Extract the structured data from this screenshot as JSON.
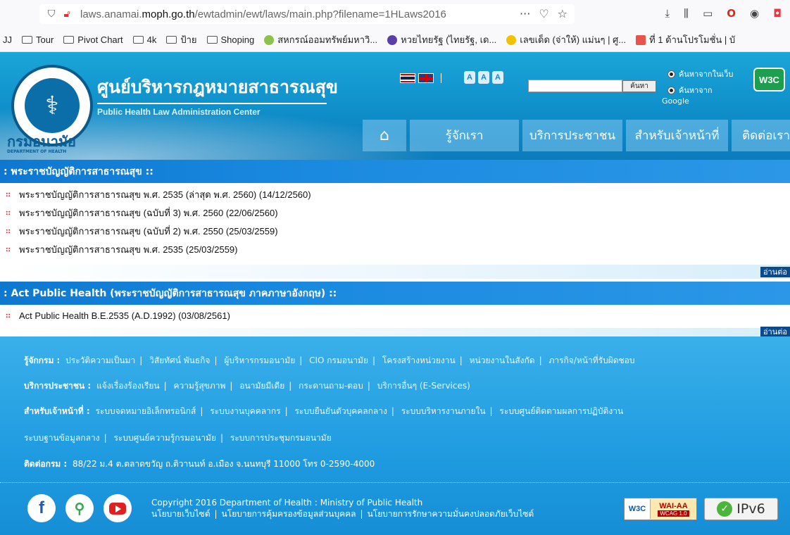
{
  "browser": {
    "url_prefix": "laws.anamai.",
    "url_domain": "moph.go.th",
    "url_path": "/ewtadmin/ewt/laws/main.php?filename=1HLaws2016",
    "bookmarks": [
      {
        "label": "Tour",
        "icon": "folder-icon"
      },
      {
        "label": "Pivot Chart",
        "icon": "folder-icon"
      },
      {
        "label": "4k",
        "icon": "folder-icon"
      },
      {
        "label": "ป้าย",
        "icon": "folder-icon"
      },
      {
        "label": "Shoping",
        "icon": "folder-icon"
      },
      {
        "label": "สหกรณ์ออมทรัพย์มหาวิ...",
        "icon": "coop-icon",
        "color": "#8bc34a"
      },
      {
        "label": "หวยไทยรัฐ (ไทยรัฐ, เด...",
        "icon": "thairath-icon",
        "color": "#5b3fa8"
      },
      {
        "label": "เลขเด็ด (จ่าให้) แม่นๆ | ศู...",
        "icon": "lottery-icon",
        "color": "#f2c200"
      },
      {
        "label": "ที่ 1 ด้านโปรโมชั่น | บั",
        "icon": "promo-icon",
        "color": "#e8534a"
      }
    ]
  },
  "header": {
    "title_th": "ศูนย์บริหารกฎหมายสาธารณสุข",
    "title_en": "Public Health Law Administration Center",
    "dept_th": "กรมอนามัย",
    "dept_en": "DEPARTMENT OF HEALTH",
    "fontsize_labels": [
      "A",
      "A",
      "A"
    ],
    "search_button": "ค้นหา",
    "search_option_site": "ค้นหาจากในเว็บ",
    "search_option_google_1": "ค้นหาจาก",
    "search_option_google_2": "Google",
    "w3c": "W3C",
    "nav": [
      "รู้จักเรา",
      "บริการประชาชน",
      "สำหรับเจ้าหน้าที่",
      "ติดต่อเรา"
    ]
  },
  "sections": [
    {
      "heading": ": พระราชบัญญัติการสาธารณสุข ::",
      "items": [
        "พระราชบัญญัติการสาธารณสุข พ.ศ. 2535 (ล่าสุด พ.ศ. 2560) (14/12/2560)",
        "พระราชบัญญัติการสาธารณสุข (ฉบับที่ 3) พ.ศ. 2560 (22/06/2560)",
        "พระราชบัญญัติการสาธารณสุข (ฉบับที่ 2) พ.ศ. 2550 (25/03/2559)",
        "พระราชบัญญัติการสาธารณสุข พ.ศ. 2535 (25/03/2559)"
      ],
      "read_more": "อ่านต่อ"
    },
    {
      "heading": ": Act Public Health (พระราชบัญญัติการสาธารณสุข ภาคภาษาอังกฤษ) ::",
      "items": [
        "Act Public Health B.E.2535 (A.D.1992) (03/08/2561)"
      ],
      "read_more": "อ่านต่อ"
    }
  ],
  "footer": {
    "about_label": "รู้จักกรม :",
    "about_links": [
      "ประวัติความเป็นมา",
      "วิสัยทัศน์ พันธกิจ",
      "ผู้บริหารกรมอนามัย",
      "CIO กรมอนามัย",
      "โครงสร้างหน่วยงาน",
      "หน่วยงานในสังกัด",
      "ภารกิจ/หน้าที่รับผิดชอบ"
    ],
    "service_label": "บริการประชาชน :",
    "service_links": [
      "แจ้งเรื่องร้องเรียน",
      "ความรู้สุขภาพ",
      "อนามัยมีเดีย",
      "กระดานถาม-ตอบ",
      "บริการอื่นๆ (E-Services)"
    ],
    "staff_label": "สำหรับเจ้าหน้าที่ :",
    "staff_links_1": [
      "ระบบจดหมายอิเล็กทรอนิกส์",
      "ระบบงานบุคคลากร",
      "ระบบยืนยันตัวบุคคลกลาง",
      "ระบบบริหารงานภายใน",
      "ระบบศูนย์ติดตามผลการปฏิบัติงาน"
    ],
    "staff_links_2": [
      "ระบบฐานข้อมูลกลาง",
      "ระบบศูนย์ความรู้กรมอนามัย",
      "ระบบการประชุมกรมอนามัย"
    ],
    "contact_label": "ติดต่อกรม :",
    "contact_text": "88/22 ม.4 ต.ตลาดขวัญ ถ.ติวานนท์ อ.เมือง จ.นนทบุรี 11000 โทร 0-2590-4000",
    "copyright": "Copyright 2016 Department of Health : Ministry of Public Health",
    "policy_links": [
      "นโยบายเว็บไซต์",
      "นโยบายการคุ้มครองข้อมูลส่วนบุคคล",
      "นโยบายการรักษาความมั่นคงปลอดภัยเว็บไซต์"
    ],
    "wai_w3c": "W3C",
    "wai_aa": "WAI-AA",
    "wai_wcag": "WCAG 1.0",
    "ipv6": "IPv6",
    "social": [
      "facebook-icon",
      "google-maps-icon",
      "youtube-icon"
    ]
  }
}
